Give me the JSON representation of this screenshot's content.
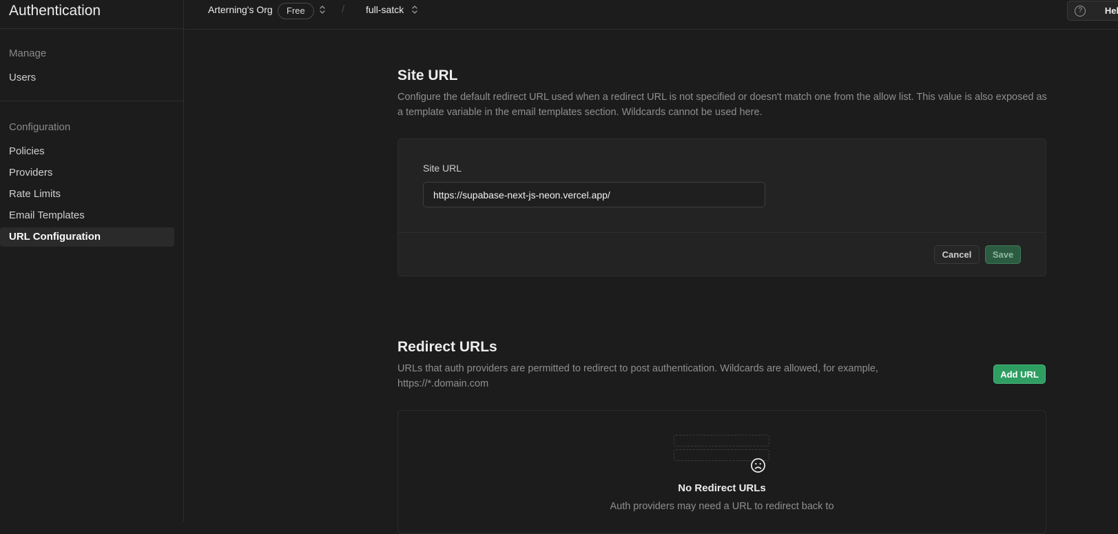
{
  "sidebar": {
    "title": "Authentication",
    "groups": [
      {
        "heading": "Manage",
        "items": [
          {
            "label": "Users"
          }
        ]
      },
      {
        "heading": "Configuration",
        "items": [
          {
            "label": "Policies"
          },
          {
            "label": "Providers"
          },
          {
            "label": "Rate Limits"
          },
          {
            "label": "Email Templates"
          },
          {
            "label": "URL Configuration",
            "active": true
          }
        ]
      }
    ]
  },
  "topbar": {
    "org": "Arterning's Org",
    "plan_badge": "Free",
    "separator": "/",
    "project": "full-satck",
    "help_label": "Help",
    "help_icon_glyph": "?"
  },
  "site_url": {
    "title": "Site URL",
    "description": "Configure the default redirect URL used when a redirect URL is not specified or doesn't match one from the allow list. This value is also exposed as a template variable in the email templates section. Wildcards cannot be used here.",
    "field_label": "Site URL",
    "value": "https://supabase-next-js-neon.vercel.app/",
    "cancel_label": "Cancel",
    "save_label": "Save"
  },
  "redirect_urls": {
    "title": "Redirect URLs",
    "description": "URLs that auth providers are permitted to redirect to post authentication. Wildcards are allowed, for example, https://*.domain.com",
    "add_label": "Add URL",
    "empty_title": "No Redirect URLs",
    "empty_subtitle": "Auth providers may need a URL to redirect back to"
  },
  "colors": {
    "background": "#1c1c1c",
    "accent_green": "#2f9e62",
    "border": "#2e2e2e"
  }
}
